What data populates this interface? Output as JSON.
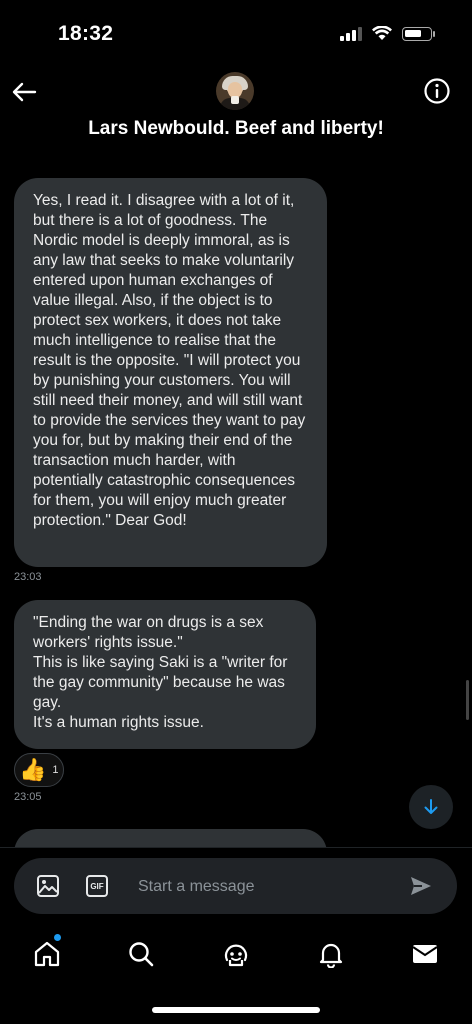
{
  "status": {
    "time": "18:32"
  },
  "header": {
    "title": "Lars Newbould. Beef and liberty!"
  },
  "messages": [
    {
      "text": "Yes, I read it. I disagree with a lot of it, but there is a lot of goodness. The Nordic model is deeply immoral, as is any law that seeks to make voluntarily entered upon human exchanges of value illegal. Also, if the object is to protect sex workers, it does not take much intelligence to realise that the result is the opposite. \"I will protect you by punishing your customers. You will still need their money, and will still want to provide the services they want to pay you for, but by making their end of the transaction much harder, with potentially catastrophic consequences for them, you will enjoy much greater protection.\" Dear God!",
      "time": "23:03"
    },
    {
      "text": "\"Ending the war on drugs is a sex workers' rights issue.\"\nThis is like saying Saki is a \"writer for the gay community\" because he was gay.\nIt's a human rights issue.",
      "time": "23:05",
      "reaction": {
        "emoji": "👍",
        "count": "1"
      }
    }
  ],
  "composer": {
    "placeholder": "Start a message",
    "gif_label": "GIF"
  },
  "colors": {
    "accent": "#1d9bf0",
    "bubble": "#2f3336",
    "background": "#000000"
  },
  "icons": [
    "back-arrow-icon",
    "info-icon",
    "image-icon",
    "gif-icon",
    "send-icon",
    "home-icon",
    "search-icon",
    "grok-icon",
    "bell-icon",
    "mail-icon",
    "arrow-down-icon"
  ]
}
